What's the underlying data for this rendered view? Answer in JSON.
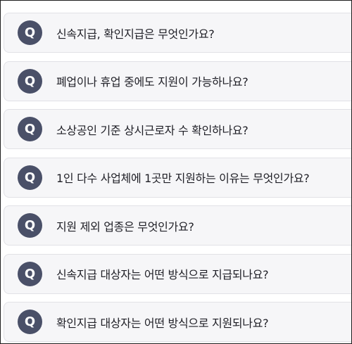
{
  "faq": {
    "badge": "Q",
    "items": [
      {
        "question": "신속지급, 확인지급은 무엇인가요?"
      },
      {
        "question": "폐업이나 휴업 중에도 지원이 가능하나요?"
      },
      {
        "question": "소상공인 기준 상시근로자 수 확인하나요?"
      },
      {
        "question": "1인 다수 사업체에 1곳만 지원하는 이유는 무엇인가요?"
      },
      {
        "question": "지원 제외 업종은 무엇인가요?"
      },
      {
        "question": "신속지급 대상자는 어떤 방식으로 지급되나요?"
      },
      {
        "question": "확인지급 대상자는 어떤 방식으로 지원되나요?"
      }
    ]
  }
}
